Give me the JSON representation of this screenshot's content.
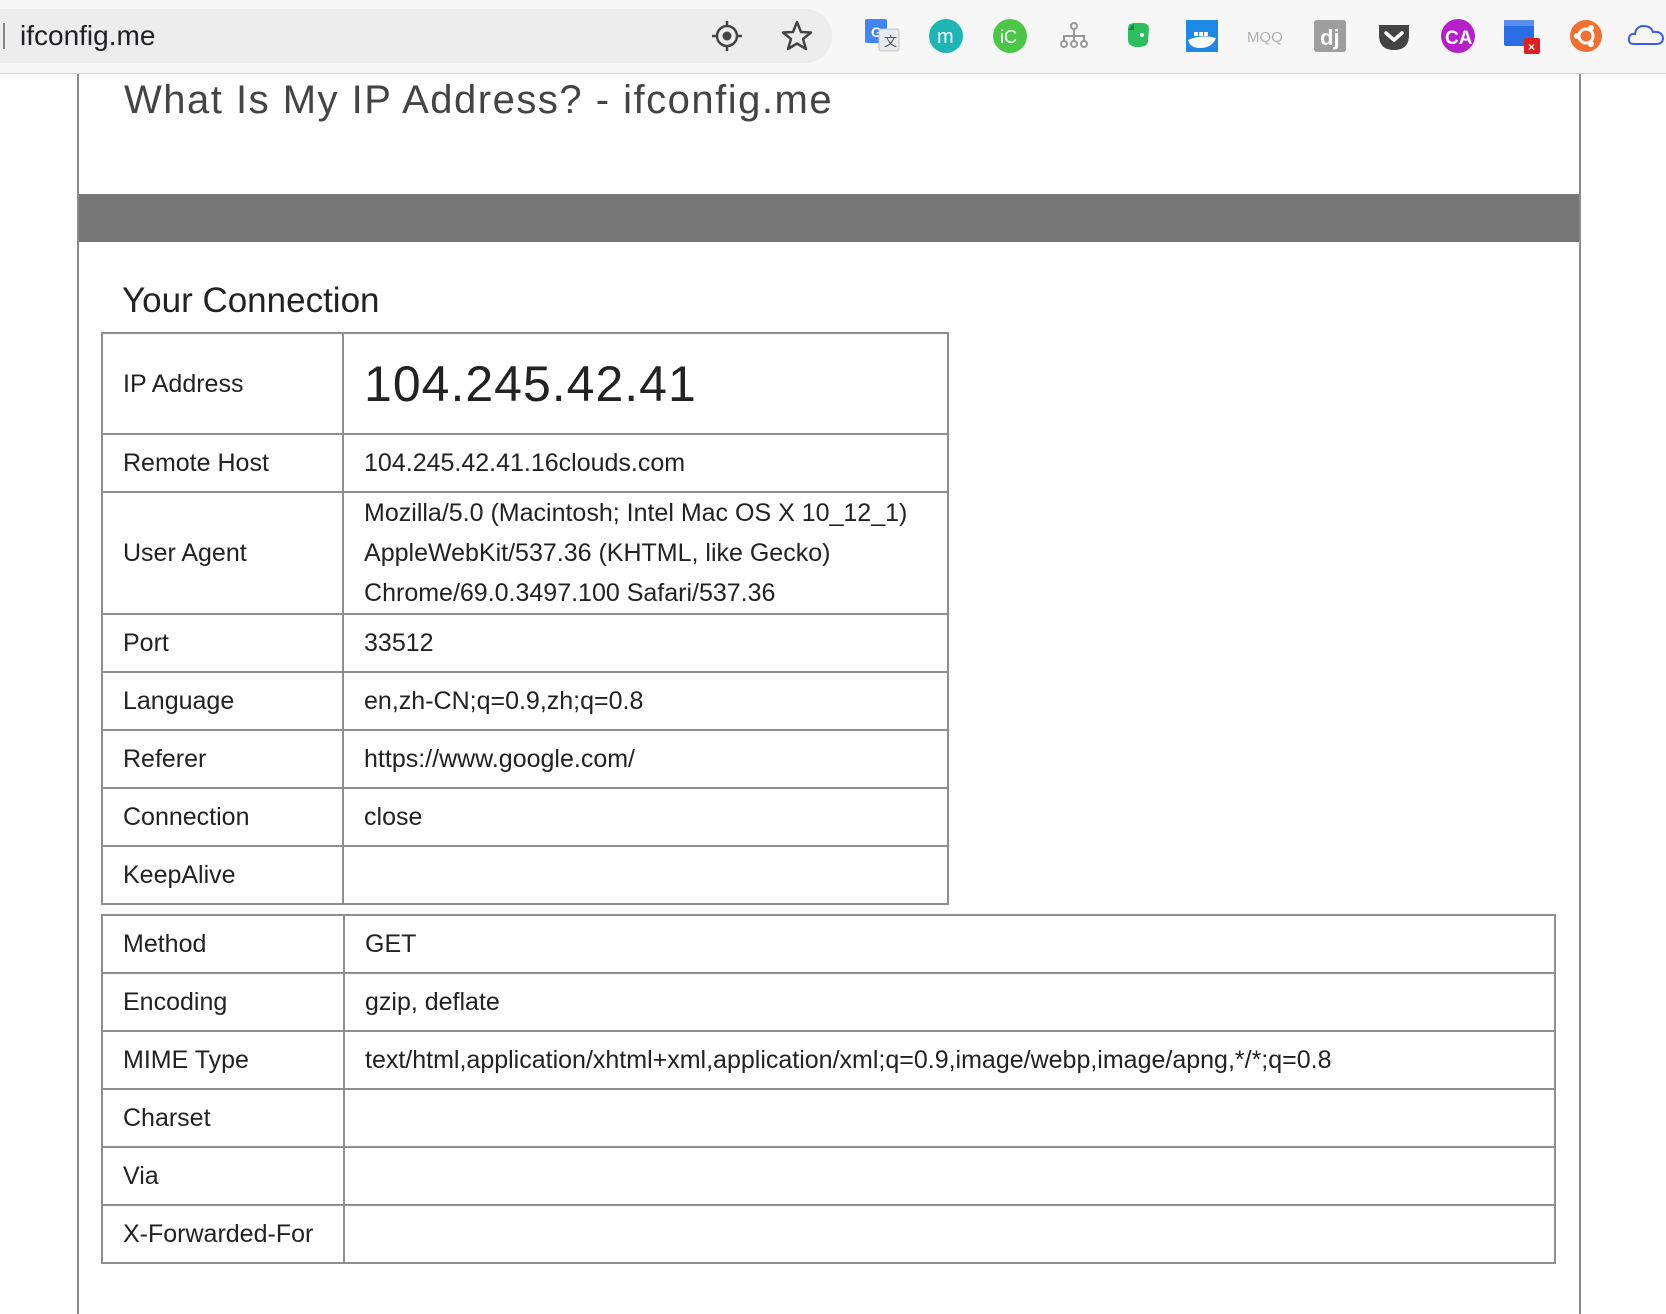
{
  "browser": {
    "url": "ifconfig.me",
    "extensions": [
      "google-translate-icon",
      "mendeley-icon",
      "icloud-icon",
      "sitemap-icon",
      "evernote-icon",
      "docker-icon",
      "mqq-icon",
      "django-icon",
      "pocket-icon",
      "ca-icon",
      "screen-capture-icon",
      "ubuntu-icon",
      "cloud-icon"
    ],
    "mqq_label": "MQQ"
  },
  "page": {
    "title": "What Is My IP Address? - ifconfig.me",
    "section_title": "Your Connection"
  },
  "connection_rows": [
    {
      "label": "IP Address",
      "value": "104.245.42.41"
    },
    {
      "label": "Remote Host",
      "value": "104.245.42.41.16clouds.com"
    },
    {
      "label": "User Agent",
      "value": "Mozilla/5.0 (Macintosh; Intel Mac OS X 10_12_1) AppleWebKit/537.36 (KHTML, like Gecko) Chrome/69.0.3497.100 Safari/537.36"
    },
    {
      "label": "Port",
      "value": "33512"
    },
    {
      "label": "Language",
      "value": "en,zh-CN;q=0.9,zh;q=0.8"
    },
    {
      "label": "Referer",
      "value": "https://www.google.com/"
    },
    {
      "label": "Connection",
      "value": "close"
    },
    {
      "label": "KeepAlive",
      "value": ""
    },
    {
      "label": "Method",
      "value": "GET"
    },
    {
      "label": "Encoding",
      "value": "gzip, deflate"
    },
    {
      "label": "MIME Type",
      "value": "text/html,application/xhtml+xml,application/xml;q=0.9,image/webp,image/apng,*/*;q=0.8"
    },
    {
      "label": "Charset",
      "value": ""
    },
    {
      "label": "Via",
      "value": ""
    },
    {
      "label": "X-Forwarded-For",
      "value": ""
    }
  ]
}
